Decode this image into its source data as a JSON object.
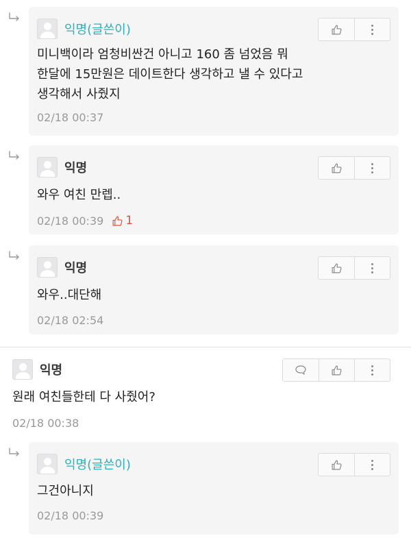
{
  "comments": [
    {
      "author": "익명(글쓴이)",
      "lines": [
        "미니백이라 엄청비싼건 아니고 160 좀 넘었음 뭐",
        "한달에 15만원은 데이트한다 생각하고 낼 수 있다고",
        "생각해서 사줬지"
      ],
      "time": "02/18 00:37"
    },
    {
      "author": "익명",
      "lines": [
        "와우 여친 만렙.."
      ],
      "time": "02/18 00:39",
      "likes": "1"
    },
    {
      "author": "익명",
      "lines": [
        "와우..대단해"
      ],
      "time": "02/18 02:54"
    },
    {
      "author": "익명",
      "lines": [
        "원래 여친들한테 다 사줬어?"
      ],
      "time": "02/18 00:38"
    },
    {
      "author": "익명(글쓴이)",
      "lines": [
        "그건아니지"
      ],
      "time": "02/18 00:39"
    }
  ],
  "icons": {
    "reply_arrow": "reply-arrow-icon",
    "like": "thumbs-up-icon",
    "more": "more-vertical-icon",
    "comment": "speech-bubble-icon"
  },
  "colors": {
    "author": "#2bb1bd",
    "like_count": "#d6543a",
    "card_bg": "#f5f5f6"
  }
}
